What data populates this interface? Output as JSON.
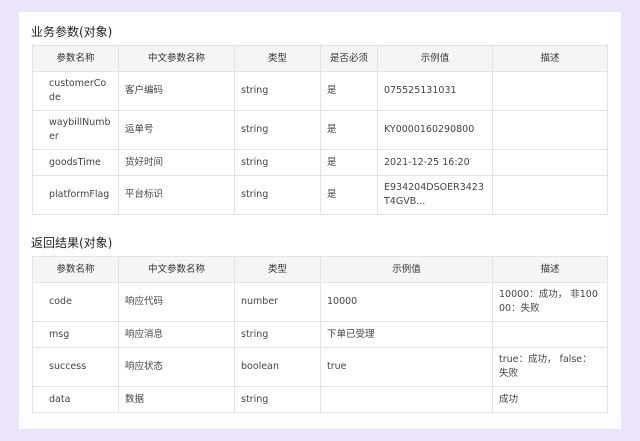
{
  "section1": {
    "title": "业务参数(对象)",
    "headers": [
      "参数名称",
      "中文参数名称",
      "类型",
      "是否必须",
      "示例值",
      "描述"
    ],
    "rows": [
      {
        "name": "customerCode",
        "cn": "客户编码",
        "type": "string",
        "required": "是",
        "example": "075525131031",
        "desc": ""
      },
      {
        "name": "waybillNumber",
        "cn": "运单号",
        "type": "string",
        "required": "是",
        "example": "KY0000160290800",
        "desc": ""
      },
      {
        "name": "goodsTime",
        "cn": "货好时间",
        "type": "string",
        "required": "是",
        "example": "2021-12-25 16:20",
        "desc": ""
      },
      {
        "name": "platformFlag",
        "cn": "平台标识",
        "type": "string",
        "required": "是",
        "example": "E934204DSOER3423T4GVB...",
        "desc": ""
      }
    ]
  },
  "section2": {
    "title": "返回结果(对象)",
    "headers": [
      "参数名称",
      "中文参数名称",
      "类型",
      "示例值",
      "描述"
    ],
    "rows": [
      {
        "name": "code",
        "cn": "响应代码",
        "type": "number",
        "example": "10000",
        "desc": "10000：成功， 非10000：失败"
      },
      {
        "name": "msg",
        "cn": "响应消息",
        "type": "string",
        "example": "下单已受理",
        "desc": ""
      },
      {
        "name": "success",
        "cn": "响应状态",
        "type": "boolean",
        "example": "true",
        "desc": "true：成功， false：失败"
      },
      {
        "name": "data",
        "cn": "数据",
        "type": "string",
        "example": "",
        "desc": "成功"
      }
    ]
  }
}
